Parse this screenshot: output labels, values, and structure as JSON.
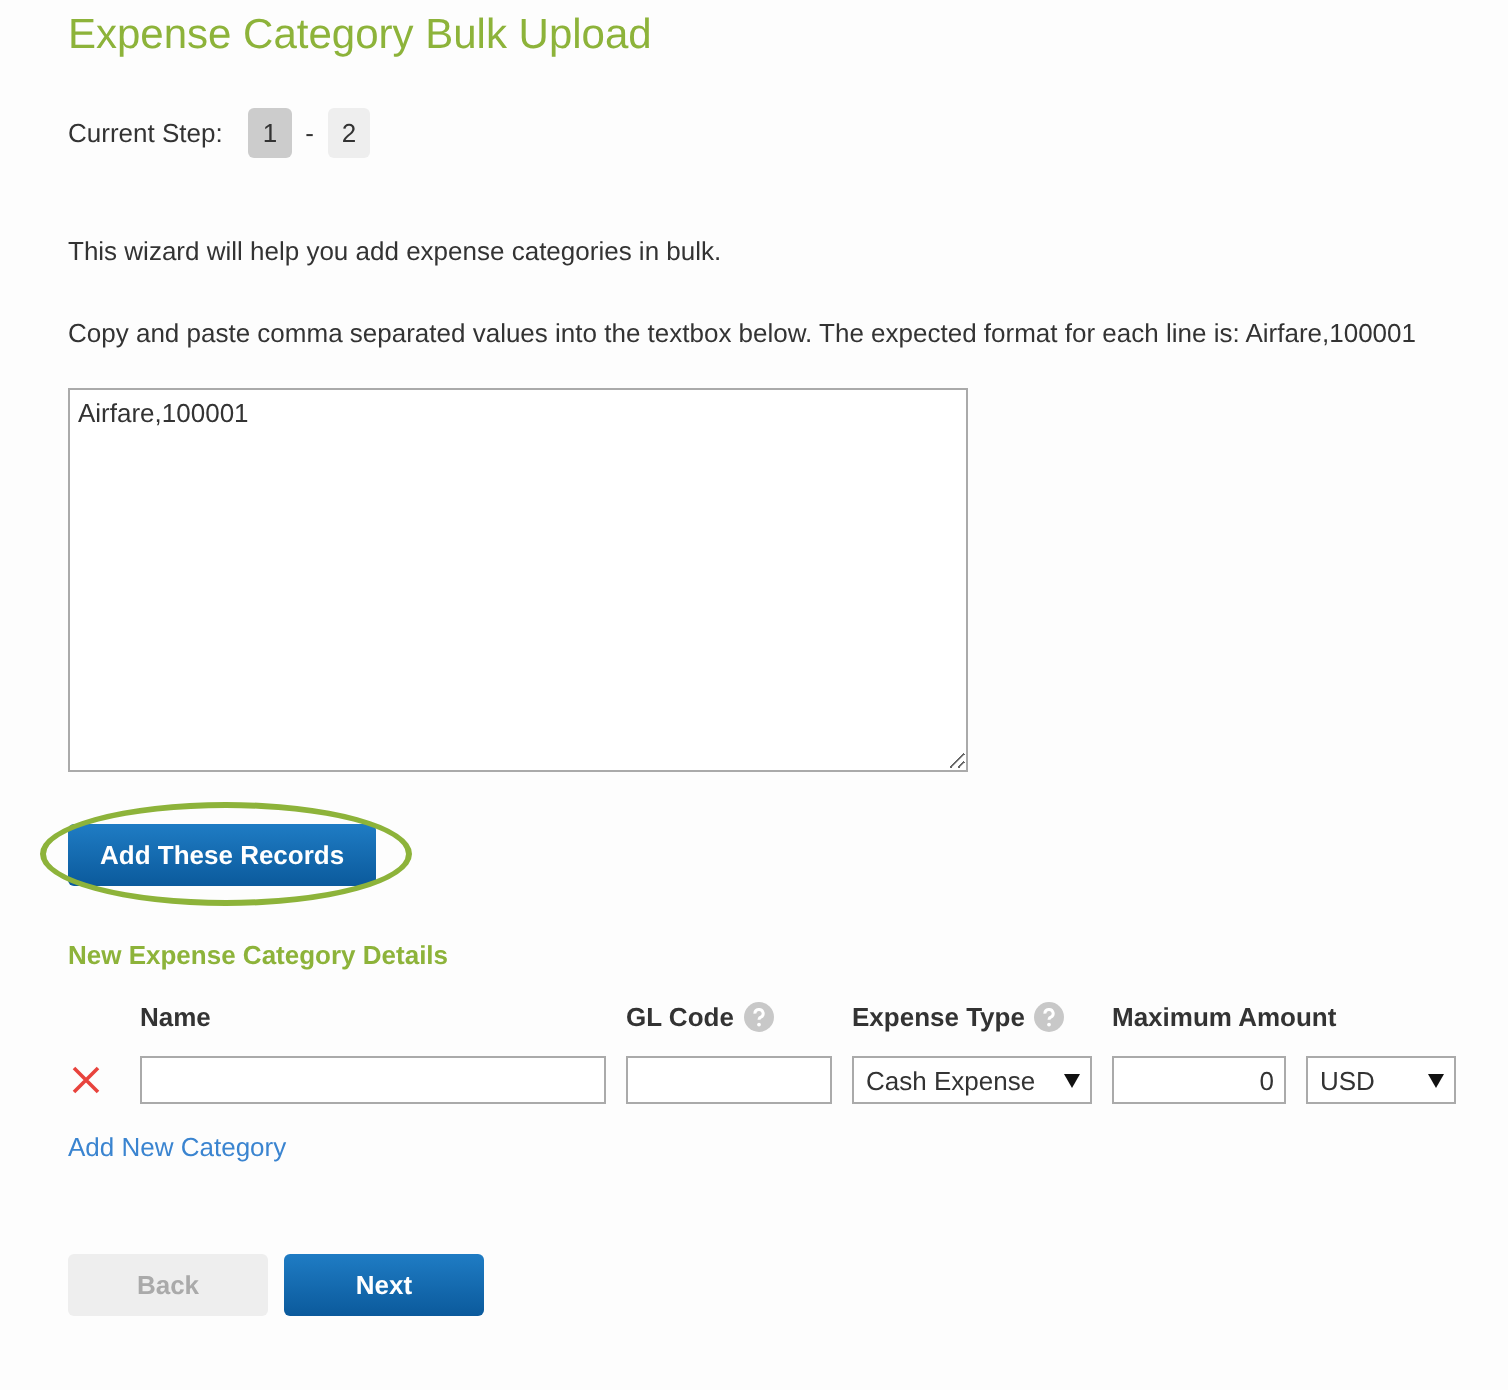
{
  "title": "Expense Category Bulk Upload",
  "step_label": "Current Step:",
  "steps": [
    {
      "label": "1",
      "selected": true
    },
    {
      "label": "2",
      "selected": false
    }
  ],
  "step_separator": "-",
  "intro": "This wizard will help you add expense categories in bulk.",
  "instructions": "Copy and paste comma separated values into the textbox below. The expected format for each line is: Airfare,100001",
  "bulk_text": "Airfare,100001",
  "add_records_button": {
    "label": "Add These Records",
    "highlighted": true
  },
  "details_heading": "New Expense Category Details",
  "columns": [
    {
      "label": "Name",
      "help": false
    },
    {
      "label": "GL Code",
      "help": true
    },
    {
      "label": "Expense Type",
      "help": true
    },
    {
      "label": "Maximum Amount",
      "help": false
    }
  ],
  "rows": [
    {
      "name": "",
      "gl_code": "",
      "expense_type": "Cash Expense",
      "maximum_amount": "0",
      "currency": "USD"
    }
  ],
  "add_category_link": "Add New Category",
  "buttons": [
    {
      "label": "Back",
      "disabled": true
    },
    {
      "label": "Next",
      "disabled": false
    }
  ]
}
